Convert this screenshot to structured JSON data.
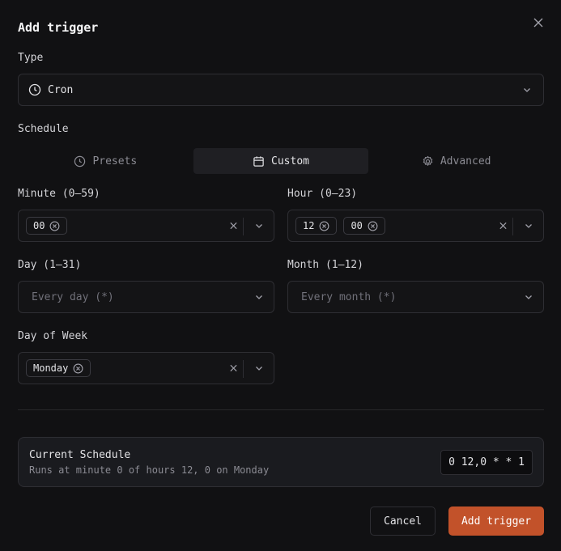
{
  "dialog": {
    "title": "Add trigger"
  },
  "type_field": {
    "label": "Type",
    "value": "Cron",
    "icon": "clock-icon"
  },
  "schedule": {
    "label": "Schedule",
    "tabs": [
      {
        "label": "Presets",
        "icon": "clock-icon",
        "active": false
      },
      {
        "label": "Custom",
        "icon": "calendar-icon",
        "active": true
      },
      {
        "label": "Advanced",
        "icon": "gear-icon",
        "active": false
      }
    ]
  },
  "fields": {
    "minute": {
      "label": "Minute (0–59)",
      "chips": [
        "00"
      ]
    },
    "hour": {
      "label": "Hour (0–23)",
      "chips": [
        "12",
        "00"
      ]
    },
    "day": {
      "label": "Day (1–31)",
      "placeholder": "Every day (*)"
    },
    "month": {
      "label": "Month (1–12)",
      "placeholder": "Every month (*)"
    },
    "day_of_week": {
      "label": "Day of Week",
      "chips": [
        "Monday"
      ]
    }
  },
  "current_schedule": {
    "heading": "Current Schedule",
    "description": "Runs at minute 0 of hours 12, 0 on Monday",
    "expression": "0 12,0 * * 1"
  },
  "actions": {
    "cancel_label": "Cancel",
    "submit_label": "Add trigger"
  },
  "colors": {
    "background": "#111113",
    "accent": "#c2522a",
    "border": "#2e2e33"
  }
}
